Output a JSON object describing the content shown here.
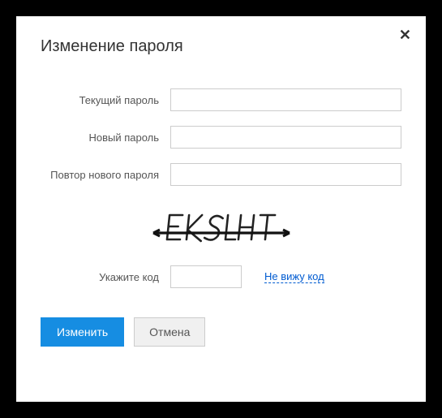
{
  "modal": {
    "title": "Изменение пароля",
    "close": "✕"
  },
  "fields": {
    "current": {
      "label": "Текущий пароль",
      "value": ""
    },
    "new": {
      "label": "Новый пароль",
      "value": ""
    },
    "repeat": {
      "label": "Повтор нового пароля",
      "value": ""
    },
    "code": {
      "label": "Укажите код",
      "value": ""
    }
  },
  "captcha": {
    "refresh_link": "Не вижу код"
  },
  "buttons": {
    "submit": "Изменить",
    "cancel": "Отмена"
  }
}
